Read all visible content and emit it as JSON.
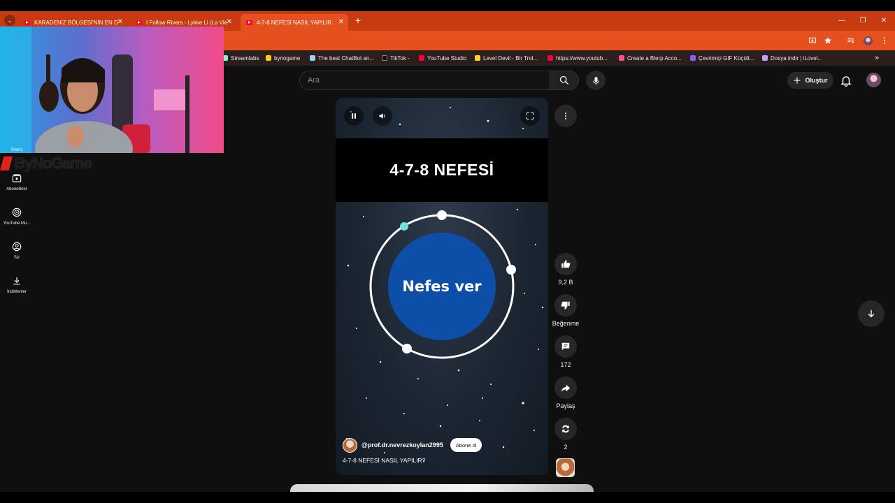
{
  "browser": {
    "tabs": [
      {
        "title": "KARADENİZ BÖLGESİ'NİN EN D",
        "active": false
      },
      {
        "title": "I Follow Rivers - Lykke Li (La Vie",
        "active": false
      },
      {
        "title": "4-7-8 NEFESİ NASIL YAPILIR",
        "active": true
      }
    ],
    "tab_close": "✕",
    "new_tab": "+",
    "tab_list": "⌄",
    "window_controls": [
      "—",
      "❐",
      "✕"
    ],
    "bookmarks": [
      {
        "label": "Streamlabs",
        "color": "#80f5d2"
      },
      {
        "label": "bynogame",
        "color": "#ffcc00"
      },
      {
        "label": "The best ChatBot an...",
        "color": "#9ad0ff"
      },
      {
        "label": "TikTok -",
        "color": "#111111"
      },
      {
        "label": "YouTube Studio",
        "color": "#ff0033"
      },
      {
        "label": "Level Devil - Bir Trol...",
        "color": "#ffd21f"
      },
      {
        "label": "https://www.youtub...",
        "color": "#ff0033"
      },
      {
        "label": "Create a Blerp Acco...",
        "color": "#ff4f8b"
      },
      {
        "label": "Çevrimiçi GIF Küçült...",
        "color": "#8a5cff"
      },
      {
        "label": "Dosya indir | iLovel...",
        "color": "#b9a7ff"
      }
    ],
    "bookmarks_more": "»"
  },
  "header": {
    "search_placeholder": "Ara",
    "create_label": "Oluştur"
  },
  "sidebar": {
    "items": [
      {
        "label": "Shorts"
      },
      {
        "label": "Abonelikler"
      },
      {
        "label": "YouTube Mu..."
      },
      {
        "label": "Siz"
      },
      {
        "label": "İndirilenler"
      }
    ]
  },
  "overlay": {
    "logo_text": "ByNoGame"
  },
  "short": {
    "banner_title": "4-7-8 NEFESİ",
    "breath_text": "Nefes ver",
    "channel_handle": "@prof.dr.nevrezkoylan2995",
    "subscribe_label": "Abone ol",
    "video_title": "4-7-8 NEFESİ NASIL YAPILIR?",
    "colors": {
      "circle_fill": "#0d4fa8",
      "ring": "#ffffff",
      "accent_dot": "#6fe3d4"
    }
  },
  "actions": {
    "likes": "9,2 B",
    "dislike_label": "Beğenme",
    "comments": "172",
    "share_label": "Paylaş",
    "remix_count": "2"
  }
}
